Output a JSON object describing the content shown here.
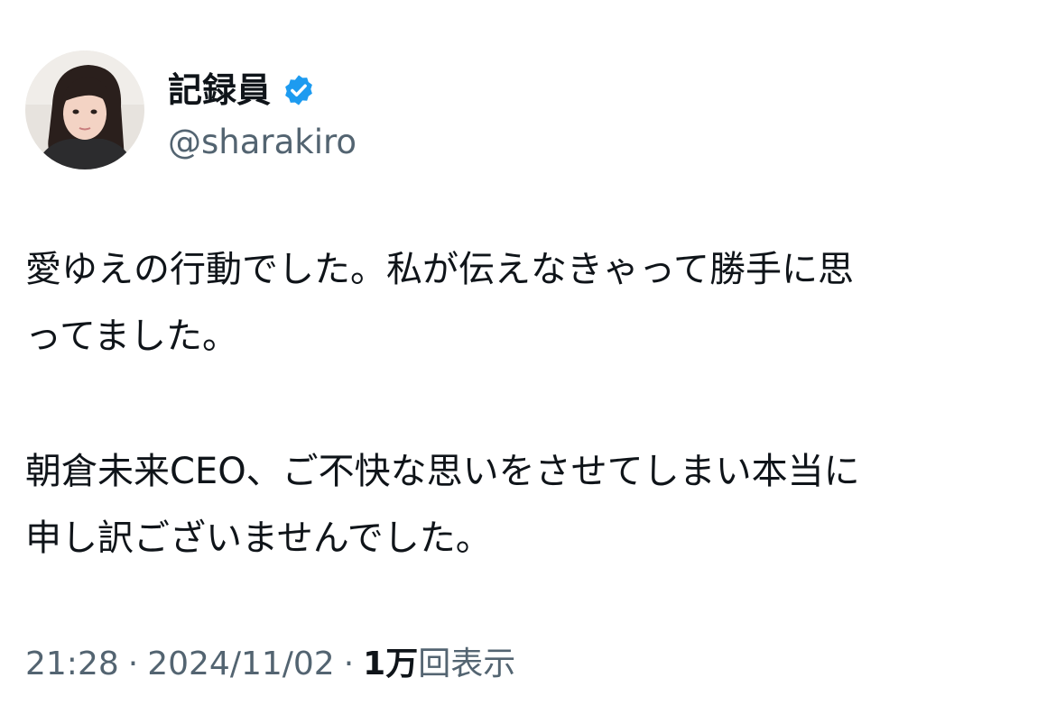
{
  "user": {
    "display_name": "記録員",
    "handle": "@sharakiro",
    "verified_icon": "verified-badge-icon",
    "verified_color": "#1d9bf0"
  },
  "tweet": {
    "paragraphs": [
      "愛ゆえの行動でした。私が伝えなきゃって勝手に思\nってました。",
      "朝倉未来CEO、ご不快な思いをさせてしまい本当に\n申し訳ございませんでした。"
    ]
  },
  "meta": {
    "time": "21:28",
    "separator": "·",
    "date": "2024/11/02",
    "views_count": "1万",
    "views_label": "回表示"
  }
}
